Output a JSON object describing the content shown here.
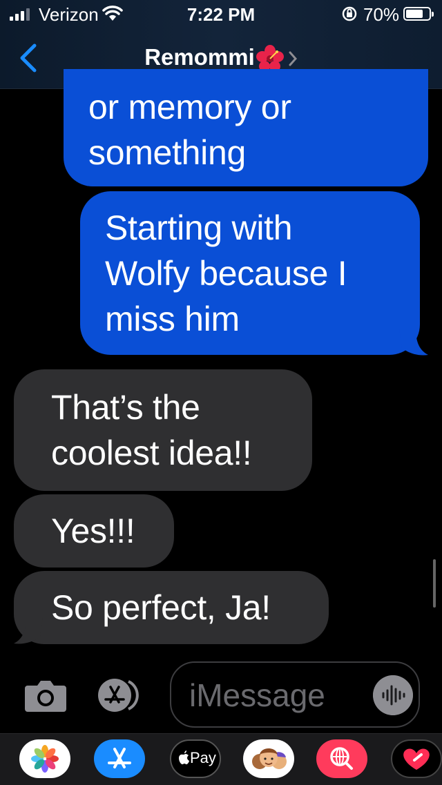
{
  "status_bar": {
    "carrier": "Verizon",
    "time": "7:22 PM",
    "battery_percent": "70%",
    "battery_level": 0.7
  },
  "nav": {
    "contact_name": "Remommi",
    "contact_emoji_icon": "hibiscus-icon"
  },
  "messages": [
    {
      "direction": "sent",
      "text_lines": [
        "or memory or",
        "something"
      ]
    },
    {
      "direction": "sent",
      "text_lines": [
        "Starting with",
        "Wolfy because I",
        "miss him"
      ]
    },
    {
      "direction": "received",
      "text_lines": [
        "That’s the",
        "coolest idea!!"
      ]
    },
    {
      "direction": "received",
      "text_lines": [
        "Yes!!!"
      ]
    },
    {
      "direction": "received",
      "text_lines": [
        "So perfect, Ja!"
      ]
    }
  ],
  "composer": {
    "placeholder": "iMessage"
  },
  "app_drawer": {
    "apple_pay_label": "Pay",
    "apps": [
      "photos-app-icon",
      "app-store-icon",
      "apple-pay-icon",
      "memoji-icon",
      "images-search-icon",
      "digital-touch-icon"
    ]
  },
  "colors": {
    "sent_bubble": "#0a4fd6",
    "received_bubble": "#2f2f31",
    "accent": "#1a8cff"
  }
}
